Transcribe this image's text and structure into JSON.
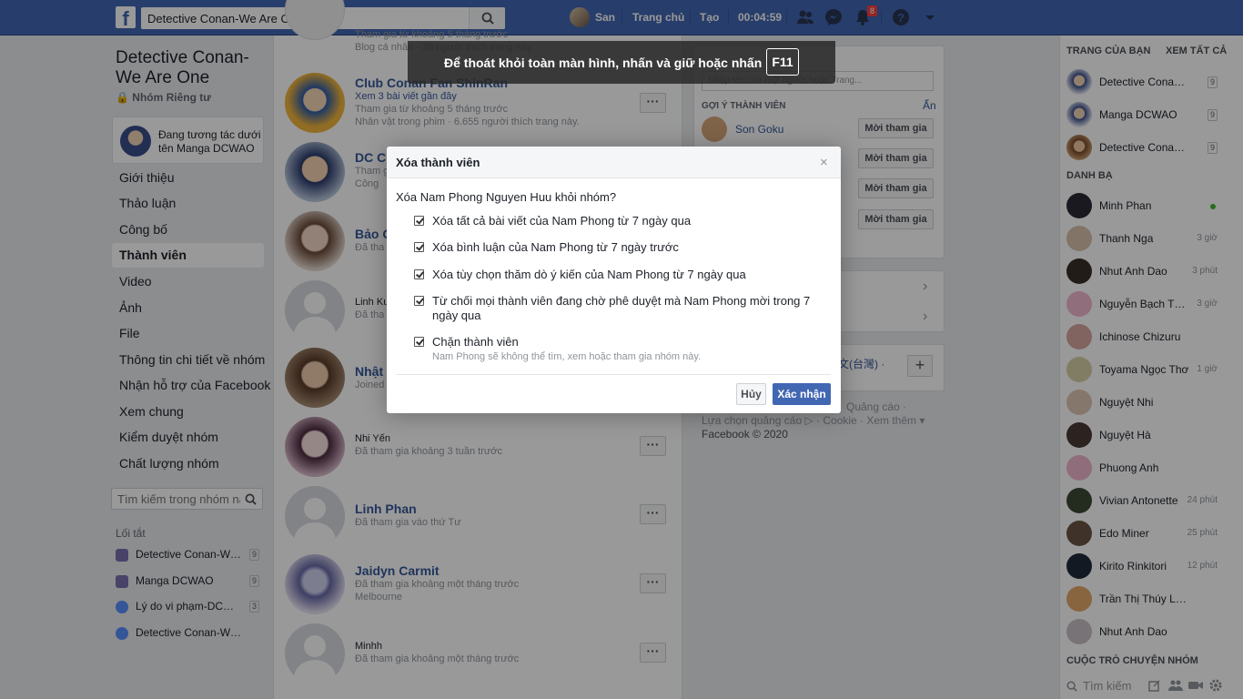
{
  "topbar": {
    "logo": "f",
    "search_value": "Detective Conan-We Are One",
    "user_name": "San",
    "home_label": "Trang chủ",
    "create_label": "Tạo",
    "timer": "00:04:59",
    "notifications_count": "8"
  },
  "group": {
    "title": "Detective Conan-We Are One",
    "privacy": "Nhóm Riêng tư",
    "interacting_as": "Đang tương tác dưới tên Manga DCWAO",
    "nav": [
      "Giới thiệu",
      "Thảo luận",
      "Công bố",
      "Thành viên",
      "Video",
      "Ảnh",
      "File",
      "Thông tin chi tiết về nhóm",
      "Nhận hỗ trợ của Facebook",
      "Xem chung",
      "Kiểm duyệt nhóm",
      "Chất lượng nhóm"
    ],
    "search_placeholder": "Tìm kiếm trong nhóm này",
    "shortcuts_title": "Lối tắt",
    "shortcuts": [
      {
        "label": "Detective Conan-We Are One",
        "count": "9"
      },
      {
        "label": "Manga DCWAO",
        "count": "9"
      },
      {
        "label": "Lý do vi phạm-DCWAO",
        "count": "3"
      },
      {
        "label": "Detective Conan-We Are One",
        "count": ""
      }
    ]
  },
  "members": {
    "m0": {
      "line1": "Tham gia từ khoảng 5 tháng trước",
      "line2": "Blog cá nhân · 38 người thích trang này."
    },
    "m1": {
      "name": "Club Conan Fan ShinRan",
      "line1": "Xem 3 bài viết gần đây",
      "line2": "Tham gia từ khoảng 5 tháng trước",
      "line3": "Nhân vật trong phim · 6.655 người thích trang này."
    },
    "m2": {
      "name": "DC Co",
      "line1": "Tham g",
      "line2": "Công"
    },
    "m3": {
      "name": "Bảo C",
      "line1": "Đã tha"
    },
    "m4": {
      "name": "Linh Ku",
      "line1": "Đã tha"
    },
    "m5": {
      "name": "Nhật T",
      "line1": "Joined"
    },
    "m6": {
      "name": "Nhi Yến",
      "line1": "Đã tham gia khoảng 3 tuần trước"
    },
    "m7": {
      "name": "Linh Phan",
      "line1": "Đã tham gia vào thứ Tư"
    },
    "m8": {
      "name": "Jaidyn Carmit",
      "line1": "Đã tham gia khoảng một tháng trước",
      "line2": "Melbourne"
    },
    "m9": {
      "name": "Minhh",
      "line1": "Đã tham gia khoảng một tháng trước"
    }
  },
  "add_panel": {
    "input_placeholder": "Nhập tên của một người hoặc Trang...",
    "suggest_title": "GỢI Ý THÀNH VIÊN",
    "hide_label": "Ẩn",
    "suggest_name": "Son Goku",
    "invite_label": "Mời tham gia",
    "lang_text": "文(台灣) ·",
    "footer1": "Quảng cáo ·",
    "footer2": "Lựa chọn quảng cáo ▷ · Cookie · Xem thêm ▾",
    "footer3": "Facebook © 2020"
  },
  "sidebar": {
    "pages_title": "TRANG CỦA BẠN",
    "see_all": "XEM TẤT CẢ",
    "pages": [
      {
        "name": "Detective Conan-We Are One",
        "count": "9"
      },
      {
        "name": "Manga DCWAO",
        "count": "9"
      },
      {
        "name": "Detective Conan - World",
        "count": "9"
      }
    ],
    "contacts_title": "DANH BẠ",
    "contacts": [
      {
        "name": "Minh Phan",
        "time": ""
      },
      {
        "name": "Thanh Nga",
        "time": "3 giờ"
      },
      {
        "name": "Nhut Anh Dao",
        "time": "3 phút"
      },
      {
        "name": "Nguyễn Bạch Thiên",
        "time": "3 giờ"
      },
      {
        "name": "Ichinose Chizuru",
        "time": ""
      },
      {
        "name": "Toyama Ngọc Thơ",
        "time": "1 giờ"
      },
      {
        "name": "Nguyệt Nhi",
        "time": ""
      },
      {
        "name": "Nguyệt Hà",
        "time": ""
      },
      {
        "name": "Phuong Anh",
        "time": ""
      },
      {
        "name": "Vivian Antonette",
        "time": "24 phút"
      },
      {
        "name": "Edo Miner",
        "time": "25 phút"
      },
      {
        "name": "Kirito Rinkitori",
        "time": "12 phút"
      },
      {
        "name": "Trần Thị Thúy Loan",
        "time": ""
      },
      {
        "name": "Nhut Anh Dao",
        "time": ""
      }
    ],
    "group_chats_title": "CUỘC TRÒ CHUYỆN NHÓM",
    "search_placeholder": "Tìm kiếm"
  },
  "toast": {
    "text": "Để thoát khỏi toàn màn hình, nhấn và giữ hoặc nhấn",
    "key": "F11"
  },
  "modal": {
    "title": "Xóa thành viên",
    "close": "×",
    "question": "Xóa Nam Phong Nguyen Huu khỏi nhóm?",
    "options": [
      {
        "label": "Xóa tất cả bài viết của Nam Phong từ 7 ngày qua",
        "checked": true
      },
      {
        "label": "Xóa bình luận của Nam Phong từ 7 ngày trước",
        "checked": true
      },
      {
        "label": "Xóa tùy chọn thăm dò ý kiến của Nam Phong từ 7 ngày qua",
        "checked": true
      },
      {
        "label": "Từ chối mọi thành viên đang chờ phê duyệt mà Nam Phong mời trong 7 ngày qua",
        "checked": true
      },
      {
        "label": "Chặn thành viên",
        "sub": "Nam Phong sẽ không thể tìm, xem hoặc tham gia nhóm này.",
        "checked": true
      }
    ],
    "cancel_label": "Hủy",
    "confirm_label": "Xác nhận"
  },
  "colors": {
    "brand": "#4267b2",
    "confirm": "#4267b2",
    "online": "#42b72a",
    "badge": "#fa3e3e"
  },
  "icons": [
    "facebook-logo",
    "search-icon",
    "friends-icon",
    "messenger-icon",
    "notifications-icon",
    "help-icon",
    "dropdown-icon",
    "lock-icon",
    "chevron-right-icon",
    "plus-icon",
    "close-icon",
    "checkbox-icon"
  ]
}
